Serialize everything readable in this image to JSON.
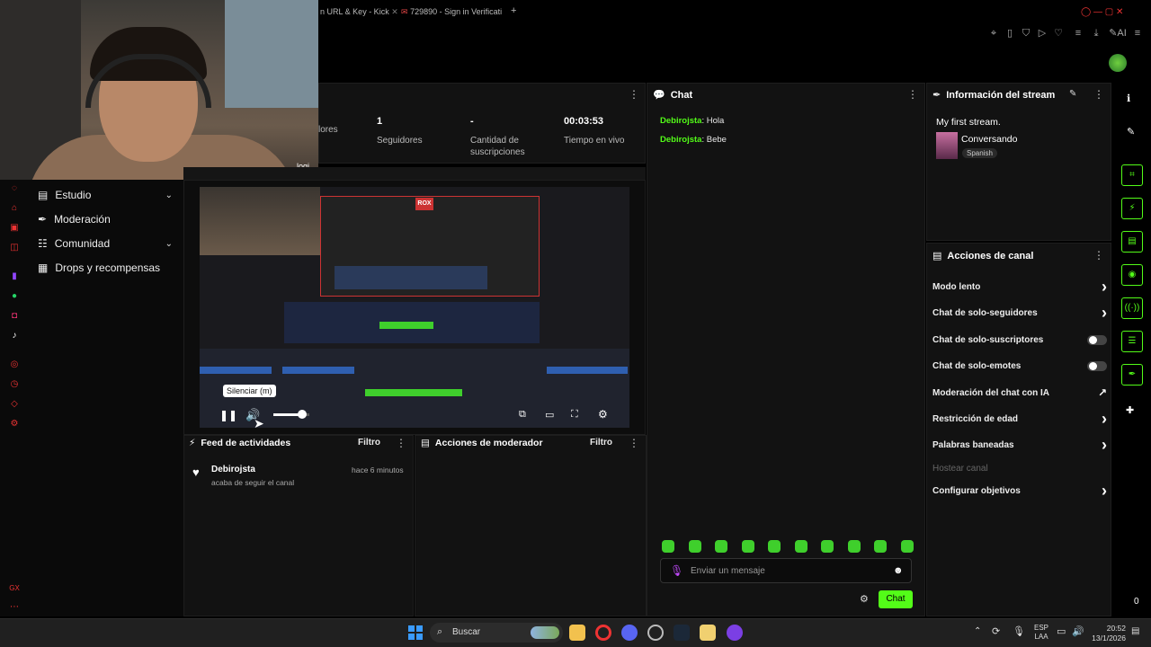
{
  "browser": {
    "tabs": [
      "n URL & Key - Kick",
      "729890 - Sign in Verificati"
    ],
    "new_tab": "+"
  },
  "webcam": {
    "overlay_text": "logi"
  },
  "sidebar": {
    "items": [
      {
        "label": "Estudio",
        "icon": "studio-icon",
        "expandable": true
      },
      {
        "label": "Moderación",
        "icon": "wrench-icon",
        "expandable": false
      },
      {
        "label": "Comunidad",
        "icon": "people-icon",
        "expandable": true
      },
      {
        "label": "Drops y recompensas",
        "icon": "gift-icon",
        "expandable": false
      }
    ]
  },
  "stats": {
    "items": [
      {
        "value": "",
        "label": "lores"
      },
      {
        "value": "1",
        "label": "Seguidores"
      },
      {
        "value": "-",
        "label": "Cantidad de suscripciones"
      },
      {
        "value": "00:03:53",
        "label": "Tiempo en vivo"
      }
    ]
  },
  "video": {
    "tooltip": "Silenciar (m)",
    "volume": 0.8,
    "badge": "ROX"
  },
  "activity_feed": {
    "title": "Feed de actividades",
    "filter": "Filtro",
    "events": [
      {
        "user": "Debirojsta",
        "text": "acaba de seguir el canal",
        "time": "hace 6 minutos"
      }
    ]
  },
  "mod_actions": {
    "title": "Acciones de moderador",
    "filter": "Filtro"
  },
  "chat": {
    "title": "Chat",
    "messages": [
      {
        "user": "Debirojsta",
        "text": "Hola"
      },
      {
        "user": "Debirojsta",
        "text": "Bebe"
      }
    ],
    "placeholder": "Enviar un mensaje",
    "send_label": "Chat",
    "emote_count": 10
  },
  "stream_info": {
    "title": "Información del stream",
    "stream_title": "My first stream.",
    "category": "Conversando",
    "language": "Spanish"
  },
  "channel_actions": {
    "title": "Acciones de canal",
    "items": [
      {
        "label": "Modo lento",
        "control": "chevron"
      },
      {
        "label": "Chat de solo-seguidores",
        "control": "chevron"
      },
      {
        "label": "Chat de solo-suscriptores",
        "control": "toggle"
      },
      {
        "label": "Chat de solo-emotes",
        "control": "toggle"
      },
      {
        "label": "Moderación del chat con IA",
        "control": "external"
      },
      {
        "label": "Restricción de edad",
        "control": "chevron"
      },
      {
        "label": "Palabras baneadas",
        "control": "chevron"
      },
      {
        "label": "Hostear canal",
        "control": "disabled"
      },
      {
        "label": "Configurar objetivos",
        "control": "chevron"
      }
    ]
  },
  "rail": {
    "bottom_count": "0"
  },
  "taskbar": {
    "search": "Buscar",
    "lang_top": "ESP",
    "lang_bottom": "LAA",
    "time": "20:52",
    "date": "13/1/2026"
  },
  "colors": {
    "accent": "#53fc18",
    "panel": "#121212",
    "bg": "#000000"
  }
}
